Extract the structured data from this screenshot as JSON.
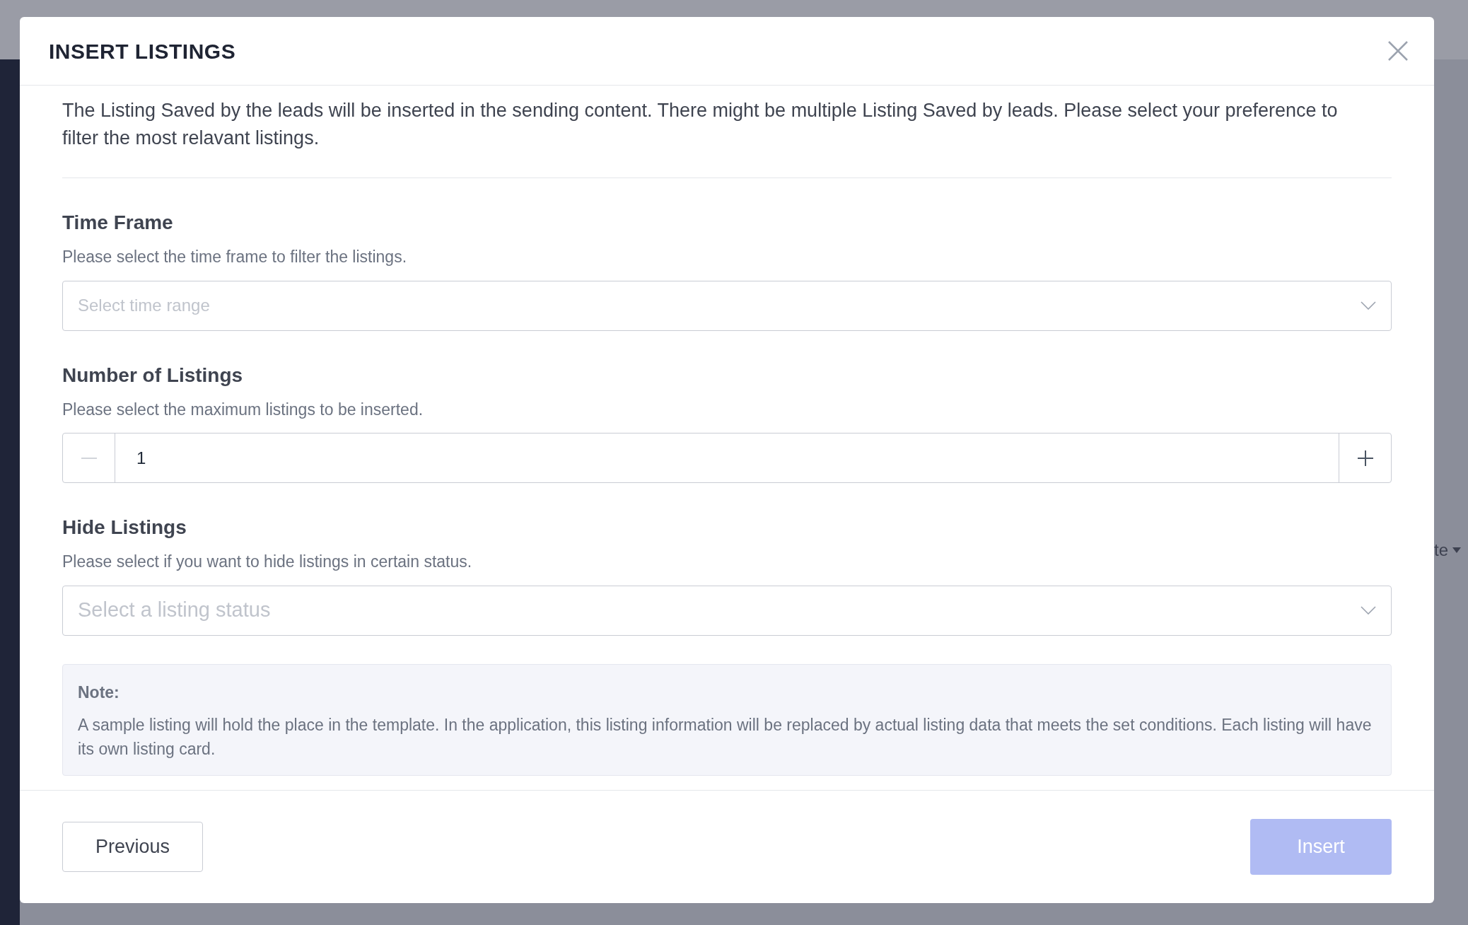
{
  "background": {
    "side_fragment": "te"
  },
  "dialog": {
    "title": "INSERT LISTINGS",
    "description": "The Listing Saved by the leads will be inserted in the sending content. There might be multiple Listing Saved by leads. Please select your preference to filter the most relavant listings.",
    "sections": [
      {
        "kind": "select",
        "title": "Time Frame",
        "hint": "Please select the time frame to filter the listings.",
        "placeholder": "Select time range"
      },
      {
        "kind": "stepper",
        "title": "Number of Listings",
        "hint": "Please select the maximum listings to be inserted.",
        "value": "1",
        "minus_disabled": true
      },
      {
        "kind": "select",
        "title": "Hide Listings",
        "hint": "Please select if you want to hide listings in certain status.",
        "placeholder": "Select a listing status",
        "large": true
      }
    ],
    "note": {
      "label": "Note:",
      "text": "A sample listing will hold the place in the template. In the application, this listing information will be replaced by actual listing data that meets the set conditions. Each listing will have its own listing card."
    },
    "buttons": [
      {
        "label": "Previous",
        "kind": "secondary",
        "disabled": false
      },
      {
        "label": "Insert",
        "kind": "primary",
        "disabled": true
      }
    ]
  }
}
